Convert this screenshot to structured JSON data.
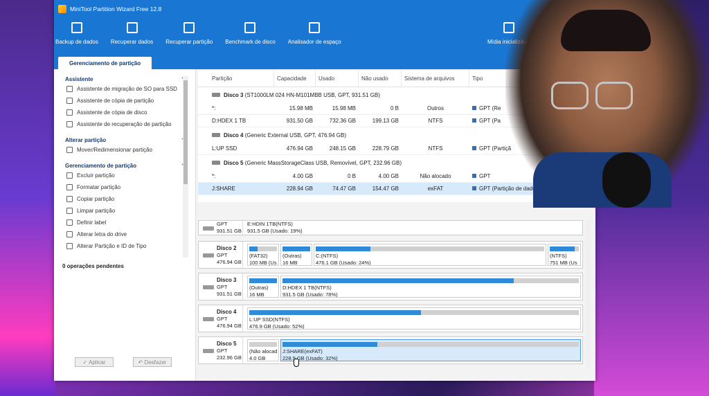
{
  "app": {
    "title": "MiniTool Partition Wizard Free 12.8",
    "controls": [
      "≡",
      "—",
      "□",
      "✕"
    ]
  },
  "toolbar": [
    {
      "label": "Backup de dados",
      "icon": "backup-icon"
    },
    {
      "label": "Recuperar dados",
      "icon": "data-recovery-icon"
    },
    {
      "label": "Recuperar partição",
      "icon": "partition-recovery-icon"
    },
    {
      "label": "Benchmark de disco",
      "icon": "benchmark-icon"
    },
    {
      "label": "Analisador de espaço",
      "icon": "space-analyzer-icon"
    },
    {
      "label": "Mídia inicializável",
      "icon": "bootable-media-icon"
    }
  ],
  "tab": "Gerenciamento de partição",
  "sidebar": {
    "sections": [
      {
        "title": "Assistente",
        "items": [
          "Assistente de migração de SO para SSD",
          "Assistente de cópia de partição",
          "Assistente de cópia de disco",
          "Assistente de recuperação de partição"
        ]
      },
      {
        "title": "Alterar partição",
        "items": [
          "Mover/Redimensionar partição"
        ]
      },
      {
        "title": "Gerenciamento de partição",
        "items": [
          "Excluir partição",
          "Formatar partição",
          "Copiar partição",
          "Limpar partição",
          "Definir label",
          "Alterar letra do drive",
          "Alterar Partição e ID de Tipo"
        ]
      }
    ],
    "pending": "0 operações pendentes",
    "apply": "✓ Aplicar",
    "undo": "↶ Desfazer"
  },
  "table": {
    "headers": [
      "Partição",
      "Capacidade",
      "Usado",
      "Não usado",
      "Sistema de arquivos",
      "Tipo"
    ],
    "disks": [
      {
        "name": "Disco 3",
        "desc": "(ST1000LM 024 HN-M101MBB USB, GPT, 931.51 GB)",
        "rows": [
          {
            "p": "*:",
            "cap": "15.98 MB",
            "used": "15.98 MB",
            "free": "0 B",
            "fs": "Outros",
            "type": "GPT (Re"
          },
          {
            "p": "D:HDEX 1 TB",
            "cap": "931.50 GB",
            "used": "732.36 GB",
            "free": "199.13 GB",
            "fs": "NTFS",
            "type": "GPT (Pa"
          }
        ]
      },
      {
        "name": "Disco 4",
        "desc": "(Generic External USB, GPT, 476.94 GB)",
        "rows": [
          {
            "p": "L:UP SSD",
            "cap": "476.94 GB",
            "used": "248.15 GB",
            "free": "228.79 GB",
            "fs": "NTFS",
            "type": "GPT (Partiçã"
          }
        ]
      },
      {
        "name": "Disco 5",
        "desc": "(Generic MassStorageClass USB, Removível, GPT, 232.96 GB)",
        "rows": [
          {
            "p": "*:",
            "cap": "4.00 GB",
            "used": "0 B",
            "free": "4.00 GB",
            "fs": "Não alocado",
            "type": "GPT"
          },
          {
            "p": "J:SHARE",
            "cap": "228.94 GB",
            "used": "74.47 GB",
            "free": "154.47 GB",
            "fs": "exFAT",
            "type": "GPT (Partição de dados)",
            "sel": true
          }
        ]
      }
    ]
  },
  "map": {
    "disks": [
      {
        "name": "",
        "sub1": "GPT",
        "sub2": "931.51 GB",
        "parts": [
          {
            "l1": "E:HDIN 1TB(NTFS)",
            "l2": "931.5 GB (Usado: 19%)",
            "used": 0.19
          }
        ]
      },
      {
        "name": "Disco 2",
        "sub1": "GPT",
        "sub2": "476.94 GB",
        "parts": [
          {
            "l1": "(FAT32)",
            "l2": "100 MB (Us",
            "used": 0.3
          },
          {
            "l1": "(Outras)",
            "l2": "16 MB",
            "used": 1.0
          },
          {
            "l1": "C:(NTFS)",
            "l2": "476.1 GB (Usado: 24%)",
            "used": 0.24
          },
          {
            "l1": "(NTFS)",
            "l2": "751 MB (Us",
            "used": 0.85
          }
        ]
      },
      {
        "name": "Disco 3",
        "sub1": "GPT",
        "sub2": "931.51 GB",
        "parts": [
          {
            "l1": "(Outras)",
            "l2": "16 MB",
            "used": 1.0
          },
          {
            "l1": "D:HDEX 1 TB(NTFS)",
            "l2": "931.5 GB (Usado: 78%)",
            "used": 0.78
          }
        ]
      },
      {
        "name": "Disco 4",
        "sub1": "GPT",
        "sub2": "476.94 GB",
        "parts": [
          {
            "l1": "L:UP SSD(NTFS)",
            "l2": "476.9 GB (Usado: 52%)",
            "used": 0.52
          }
        ]
      },
      {
        "name": "Disco 5",
        "sub1": "GPT",
        "sub2": "232.96 GB",
        "parts": [
          {
            "l1": "(Não alocad",
            "l2": "4.0 GB",
            "used": 0
          },
          {
            "l1": "J:SHARE(exFAT)",
            "l2": "228.9 GB (Usado: 32%)",
            "used": 0.32,
            "sel": true
          }
        ]
      }
    ]
  },
  "colors": {
    "accent": "#1976d2",
    "bar": "#2f8bd8",
    "selected": "#d6eafc"
  }
}
